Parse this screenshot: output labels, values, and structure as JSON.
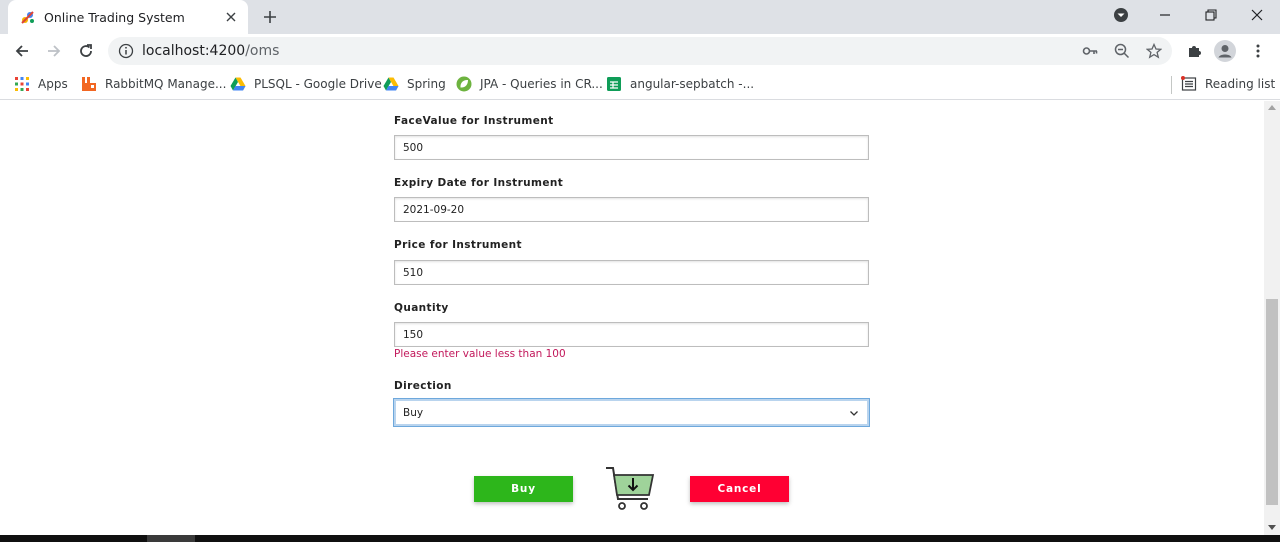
{
  "browser": {
    "tab": {
      "title": "Online Trading System"
    },
    "url": {
      "host": "localhost:4200",
      "path": "/oms"
    },
    "bookmarks": [
      {
        "label": "Apps",
        "icon": "apps-grid-icon"
      },
      {
        "label": "RabbitMQ Manage...",
        "icon": "rabbitmq-icon"
      },
      {
        "label": "PLSQL - Google Drive",
        "icon": "google-drive-icon"
      },
      {
        "label": "Spring",
        "icon": "google-drive-icon"
      },
      {
        "label": "JPA - Queries in CR...",
        "icon": "spring-leaf-icon"
      },
      {
        "label": "angular-sepbatch -...",
        "icon": "google-sheets-icon"
      }
    ],
    "reading_list": "Reading list"
  },
  "form": {
    "facevalue": {
      "label": "FaceValue for Instrument",
      "value": "500"
    },
    "expiry": {
      "label": "Expiry Date for Instrument",
      "value": "2021-09-20"
    },
    "price": {
      "label": "Price for Instrument",
      "value": "510"
    },
    "quantity": {
      "label": "Quantity",
      "value": "150",
      "error": "Please enter value less than 100"
    },
    "direction": {
      "label": "Direction",
      "selected": "Buy"
    },
    "buy_label": "Buy",
    "cancel_label": "Cancel"
  },
  "colors": {
    "buy_button": "#2db61b",
    "cancel_button": "#ff0033",
    "error_text": "#c2185b",
    "cart_fill": "#9fd39a"
  }
}
